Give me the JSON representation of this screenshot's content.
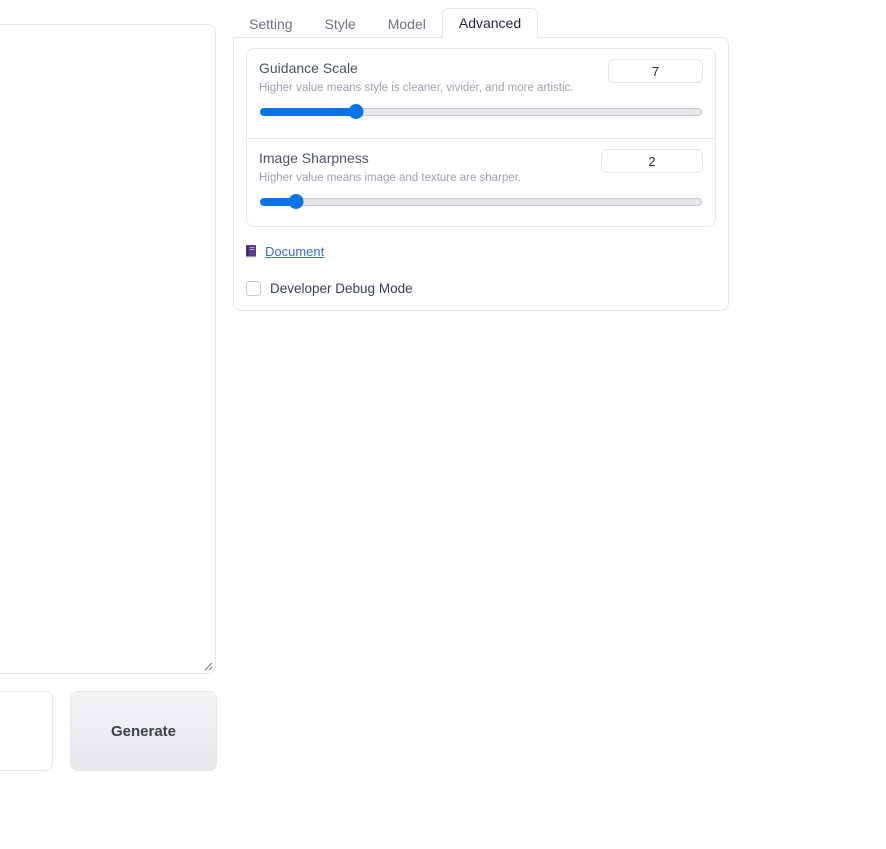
{
  "left": {
    "generate_label": "Generate"
  },
  "tabs": [
    {
      "label": "Setting",
      "active": false
    },
    {
      "label": "Style",
      "active": false
    },
    {
      "label": "Model",
      "active": false
    },
    {
      "label": "Advanced",
      "active": true
    }
  ],
  "advanced": {
    "guidance_scale": {
      "label": "Guidance Scale",
      "info": "Higher value means style is cleaner, vivider, and more artistic.",
      "value": "7",
      "fill_fraction": 0.215
    },
    "image_sharpness": {
      "label": "Image Sharpness",
      "info": "Higher value means image and texture are sharper.",
      "value": "2",
      "fill_fraction": 0.08
    },
    "document_link": "Document",
    "debug_label": "Developer Debug Mode",
    "debug_checked": false
  },
  "colors": {
    "accent": "#0b74e7",
    "link": "#3b6fbf",
    "border": "#e5e7eb"
  },
  "icons": {
    "document": "book-icon",
    "resize": "resize-handle-icon"
  }
}
